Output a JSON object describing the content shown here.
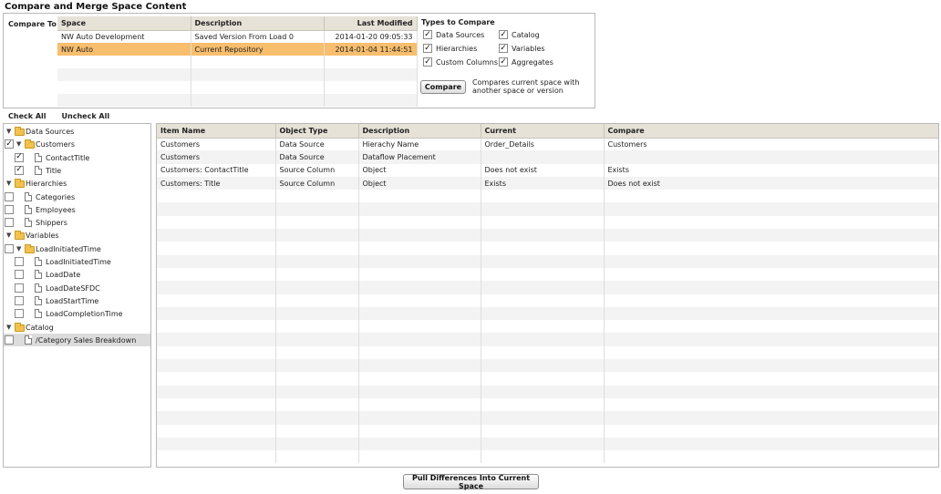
{
  "page": {
    "title": "Compare and Merge Space Content"
  },
  "compare_to": {
    "label": "Compare To",
    "columns": [
      "Space",
      "Description",
      "Last Modified"
    ],
    "rows": [
      {
        "space": "NW Auto Development",
        "description": "Saved Version From Load 0",
        "last_modified": "2014-01-20 09:05:33"
      },
      {
        "space": "NW Auto",
        "description": "Current Repository",
        "last_modified": "2014-01-04 11:44:51"
      }
    ]
  },
  "types_to_compare": {
    "title": "Types to Compare",
    "items": [
      {
        "label": "Data Sources",
        "checked": true
      },
      {
        "label": "Catalog",
        "checked": true
      },
      {
        "label": "Hierarchies",
        "checked": true
      },
      {
        "label": "Variables",
        "checked": true
      },
      {
        "label": "Custom Columns",
        "checked": true
      },
      {
        "label": "Aggregates",
        "checked": true
      }
    ]
  },
  "compare_button": {
    "label": "Compare",
    "description": "Compares current space with another space or version"
  },
  "check_all": {
    "check_label": "Check All",
    "uncheck_label": "Uncheck All"
  },
  "tree": [
    {
      "label": "Data Sources",
      "type": "folder",
      "level": 0,
      "has_checkbox": false,
      "expanded": true
    },
    {
      "label": "Customers",
      "type": "folder",
      "level": 1,
      "has_checkbox": true,
      "checked": true,
      "expanded": true
    },
    {
      "label": "ContactTitle",
      "type": "doc",
      "level": 2,
      "has_checkbox": true,
      "checked": true
    },
    {
      "label": "Title",
      "type": "doc",
      "level": 2,
      "has_checkbox": true,
      "checked": true
    },
    {
      "label": "Hierarchies",
      "type": "folder",
      "level": 0,
      "has_checkbox": false,
      "expanded": true
    },
    {
      "label": "Categories",
      "type": "doc",
      "level": 1,
      "has_checkbox": true,
      "checked": false
    },
    {
      "label": "Employees",
      "type": "doc",
      "level": 1,
      "has_checkbox": true,
      "checked": false
    },
    {
      "label": "Shippers",
      "type": "doc",
      "level": 1,
      "has_checkbox": true,
      "checked": false
    },
    {
      "label": "Variables",
      "type": "folder",
      "level": 0,
      "has_checkbox": false,
      "expanded": true
    },
    {
      "label": "LoadInitiatedTime",
      "type": "folder",
      "level": 1,
      "has_checkbox": true,
      "checked": false,
      "expanded": true
    },
    {
      "label": "LoadInitiatedTime",
      "type": "doc",
      "level": 2,
      "has_checkbox": true,
      "checked": false
    },
    {
      "label": "LoadDate",
      "type": "doc",
      "level": 2,
      "has_checkbox": true,
      "checked": false
    },
    {
      "label": "LoadDateSFDC",
      "type": "doc",
      "level": 2,
      "has_checkbox": true,
      "checked": false
    },
    {
      "label": "LoadStartTime",
      "type": "doc",
      "level": 2,
      "has_checkbox": true,
      "checked": false
    },
    {
      "label": "LoadCompletionTime",
      "type": "doc",
      "level": 2,
      "has_checkbox": true,
      "checked": false
    },
    {
      "label": "Catalog",
      "type": "folder",
      "level": 0,
      "has_checkbox": false,
      "expanded": true
    },
    {
      "label": "/Category Sales Breakdown",
      "type": "doc",
      "level": 1,
      "has_checkbox": true,
      "checked": false,
      "selected": true
    }
  ],
  "diff_grid": {
    "columns": [
      "Item Name",
      "Object Type",
      "Description",
      "Current",
      "Compare"
    ],
    "rows": [
      [
        "Customers",
        "Data Source",
        "Hierachy Name",
        "Order_Details",
        "Customers"
      ],
      [
        "Customers",
        "Data Source",
        "Dataflow Placement",
        "",
        ""
      ],
      [
        "Customers: ContactTitle",
        "Source Column",
        "Object",
        "Does not exist",
        "Exists"
      ],
      [
        "Customers: Title",
        "Source Column",
        "Object",
        "Exists",
        "Does not exist"
      ]
    ]
  },
  "pull_button": {
    "label": "Pull Differences Into Current Space"
  },
  "colors": {
    "header_bg": "#e6e2d8",
    "selected_row": "#f7be6d",
    "folder": "#f3c24c"
  }
}
